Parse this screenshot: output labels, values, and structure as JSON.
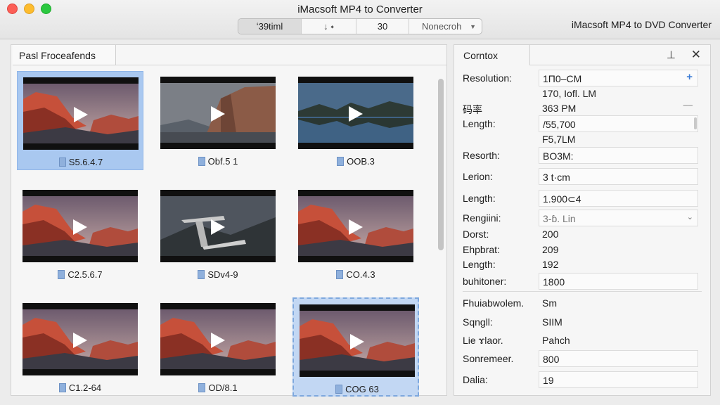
{
  "window": {
    "title": "iMacsoft MP4 to Converter",
    "right_title": "iMacsoft MP4 to DVD Converter"
  },
  "toolbar": {
    "segments": [
      "ʻ39timl",
      "↓ ⬩",
      "30",
      "Nonecroh"
    ]
  },
  "left_panel": {
    "tab_label": "Pasl Froceafends",
    "thumbnails": [
      {
        "caption": "S5.6.4.7",
        "scene": "sunset"
      },
      {
        "caption": "Obf.5 1",
        "scene": "cliff"
      },
      {
        "caption": "OOB.3",
        "scene": "lake"
      },
      {
        "caption": "C2.5.6.7",
        "scene": "sunset"
      },
      {
        "caption": "SDv4-9",
        "scene": "bridge"
      },
      {
        "caption": "CO.4.3",
        "scene": "sunset"
      },
      {
        "caption": "C1.2-64",
        "scene": "sunset"
      },
      {
        "caption": "OD/8.1",
        "scene": "sunset"
      },
      {
        "caption": "COG 63",
        "scene": "sunset"
      }
    ]
  },
  "right_panel": {
    "tab_label": "Corntox",
    "rows": [
      {
        "label": "Resolution:",
        "value": "1Π0–CM"
      },
      {
        "label": "",
        "value": "170, Iofl. LM"
      },
      {
        "label": "码率",
        "value": "363 PM"
      },
      {
        "label": "Length:",
        "value": "/55,700"
      },
      {
        "label": "",
        "value": "F5,7LM"
      },
      {
        "label": "Resorth:",
        "value": "BO3M:"
      },
      {
        "label": "Lerion:",
        "value": "3 t·cm"
      },
      {
        "label": "Length:",
        "value": "1.900⊂4"
      },
      {
        "label": "Rengiini:",
        "value": "3-ɓ. Lin"
      },
      {
        "label": "Dorst:",
        "value": "200"
      },
      {
        "label": "Ehpbrat:",
        "value": "209"
      },
      {
        "label": "Length:",
        "value": "192"
      },
      {
        "label": "buhitoner:",
        "value": "1800"
      },
      {
        "label": "Fhuiabwolem.",
        "value": "Sm"
      },
      {
        "label": "Sqngll:",
        "value": "SIIM"
      },
      {
        "label": "Lie ɤlaor.",
        "value": "Pahch"
      },
      {
        "label": "Sonremeer.",
        "value": "800"
      },
      {
        "label": "Dalia:",
        "value": "19"
      }
    ]
  },
  "colors": {
    "selection": "#a9c8f0",
    "accent": "#3a7bd5"
  },
  "icons": [
    "pin-icon",
    "close-icon",
    "play-icon",
    "file-icon",
    "plus-icon",
    "chevron-down-icon"
  ]
}
